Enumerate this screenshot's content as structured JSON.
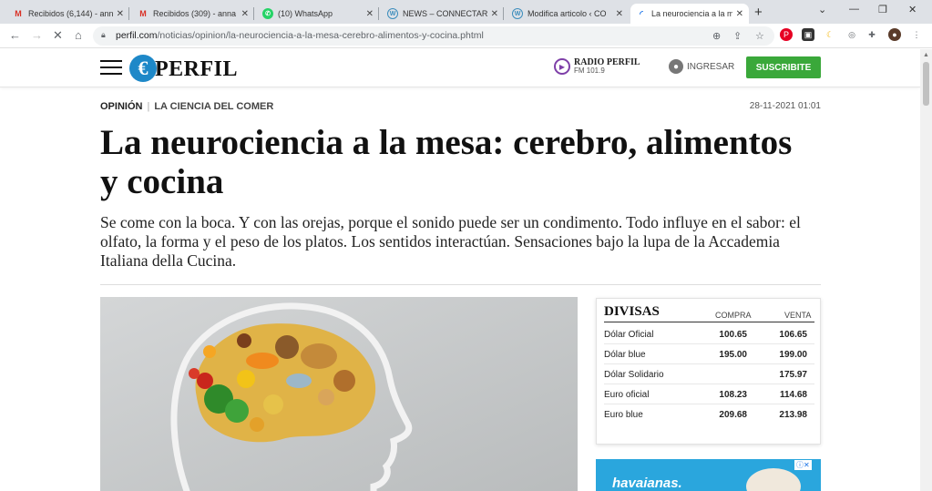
{
  "browser": {
    "tabs": [
      {
        "title": "Recibidos (6,144) - ann",
        "favicon": "gmail-icon"
      },
      {
        "title": "Recibidos (309) - anna",
        "favicon": "gmail-icon"
      },
      {
        "title": "(10) WhatsApp",
        "favicon": "whatsapp-icon"
      },
      {
        "title": "NEWS – CONNECTAR",
        "favicon": "wordpress-icon"
      },
      {
        "title": "Modifica articolo ‹ CO",
        "favicon": "wordpress-icon"
      },
      {
        "title": "La neurociencia a la m",
        "favicon": "loading-icon",
        "active": true
      }
    ],
    "url_host": "perfil.com",
    "url_path": "/noticias/opinion/la-neurociencia-a-la-mesa-cerebro-alimentos-y-cocina.phtml"
  },
  "site": {
    "logo_text": "PERFIL",
    "radio_name": "RADIO PERFIL",
    "radio_freq": "FM 101.9",
    "login_label": "INGRESAR",
    "subscribe_label": "SUSCRIBITE",
    "accent": "#3aa83a"
  },
  "article": {
    "section": "OPINIÓN",
    "topic": "LA CIENCIA DEL COMER",
    "date": "28-11-2021 01:01",
    "headline": "La neurociencia a la mesa: cerebro, alimentos y cocina",
    "subhead": "Se come con la boca. Y con las orejas, porque el sonido puede ser un condimento. Todo influye en el sabor: el olfato, la forma y el peso de los platos. Los sentidos interactúan. Sensaciones bajo la lupa de la Accademia Italiana della Cucina."
  },
  "divisas": {
    "title": "DIVISAS",
    "col_buy": "COMPRA",
    "col_sell": "VENTA",
    "rows": [
      {
        "name": "Dólar Oficial",
        "buy": "100.65",
        "sell": "106.65"
      },
      {
        "name": "Dólar blue",
        "buy": "195.00",
        "sell": "199.00"
      },
      {
        "name": "Dólar Solidario",
        "buy": "",
        "sell": "175.97"
      },
      {
        "name": "Euro oficial",
        "buy": "108.23",
        "sell": "114.68"
      },
      {
        "name": "Euro blue",
        "buy": "209.68",
        "sell": "213.98"
      }
    ]
  },
  "ad": {
    "brand": "havaianas."
  }
}
